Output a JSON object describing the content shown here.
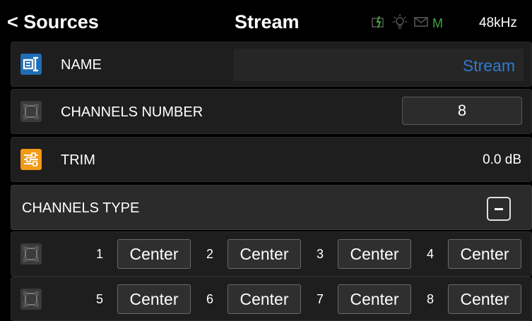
{
  "header": {
    "back_label": "< Sources",
    "title": "Stream",
    "status_indicator_letter": "M",
    "sample_rate": "48kHz",
    "status_icons": [
      "battery-charging-icon",
      "light-bulb-icon",
      "mail-icon"
    ],
    "colors": {
      "status_ok": "#3ea33e",
      "accent_blue": "#2f7ad1",
      "accent_orange": "#f39a16"
    }
  },
  "name_row": {
    "label": "NAME",
    "value": "Stream",
    "icon": "rename-icon"
  },
  "channels_row": {
    "label": "CHANNELS NUMBER",
    "value": "8",
    "icon": "channels-icon"
  },
  "trim_row": {
    "label": "TRIM",
    "value": "0.0 dB",
    "icon": "sliders-icon"
  },
  "channels_type": {
    "label": "CHANNELS TYPE",
    "icon": "collapse-icon",
    "channels": [
      {
        "num": "1",
        "type": "Center"
      },
      {
        "num": "2",
        "type": "Center"
      },
      {
        "num": "3",
        "type": "Center"
      },
      {
        "num": "4",
        "type": "Center"
      },
      {
        "num": "5",
        "type": "Center"
      },
      {
        "num": "6",
        "type": "Center"
      },
      {
        "num": "7",
        "type": "Center"
      },
      {
        "num": "8",
        "type": "Center"
      }
    ]
  }
}
